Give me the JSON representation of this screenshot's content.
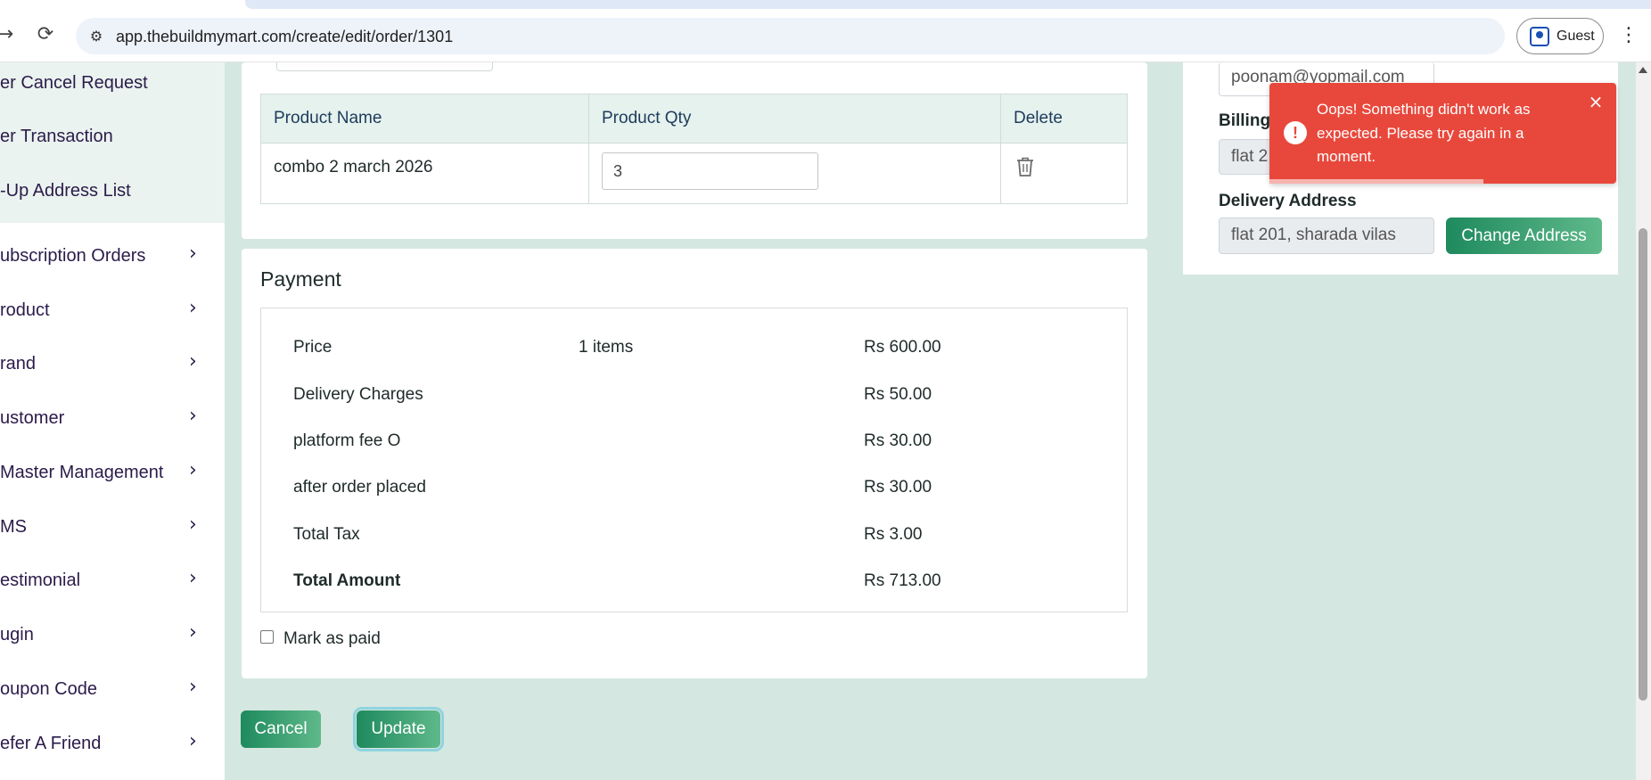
{
  "browser": {
    "url": "app.thebuildmymart.com/create/edit/order/1301",
    "profile_label": "Guest"
  },
  "sidebar": {
    "sub_items": [
      {
        "label": "er Cancel Request"
      },
      {
        "label": "er Transaction"
      },
      {
        "label": "-Up Address List"
      }
    ],
    "items": [
      {
        "label": "ubscription Orders"
      },
      {
        "label": "roduct"
      },
      {
        "label": "rand"
      },
      {
        "label": "ustomer"
      },
      {
        "label": "Master Management"
      },
      {
        "label": "MS"
      },
      {
        "label": "estimonial"
      },
      {
        "label": "ugin"
      },
      {
        "label": "oupon Code"
      },
      {
        "label": "efer A Friend"
      }
    ]
  },
  "products": {
    "headers": {
      "name": "Product Name",
      "qty": "Product Qty",
      "delete": "Delete"
    },
    "rows": [
      {
        "name": "combo 2 march 2026",
        "qty": "3"
      }
    ]
  },
  "payment": {
    "title": "Payment",
    "rows": [
      {
        "label": "Price",
        "middle": "1 items",
        "amount": "Rs 600.00"
      },
      {
        "label": "Delivery Charges",
        "middle": "",
        "amount": "Rs 50.00"
      },
      {
        "label": "platform fee O",
        "middle": "",
        "amount": "Rs 30.00"
      },
      {
        "label": "after order placed",
        "middle": "",
        "amount": "Rs 30.00"
      },
      {
        "label": "Total Tax",
        "middle": "",
        "amount": "Rs 3.00"
      },
      {
        "label": "Total Amount",
        "middle": "",
        "amount": "Rs 713.00"
      }
    ],
    "mark_paid_label": "Mark as paid"
  },
  "actions": {
    "cancel_label": "Cancel",
    "update_label": "Update"
  },
  "customer": {
    "email_value": "poonam@yopmail.com",
    "billing_label": "Billing",
    "billing_value": "flat 2",
    "delivery_label": "Delivery Address",
    "delivery_value": "flat 201, sharada vilas",
    "change_address_label": "Change Address"
  },
  "toast": {
    "message": "Oops! Something didn't work as expected. Please try again in a moment."
  },
  "colors": {
    "page_bg": "#d5e7e1",
    "accent_green": "#1e8a5e",
    "toast_red": "#e8483c",
    "sidebar_text": "#2b1b4a"
  }
}
